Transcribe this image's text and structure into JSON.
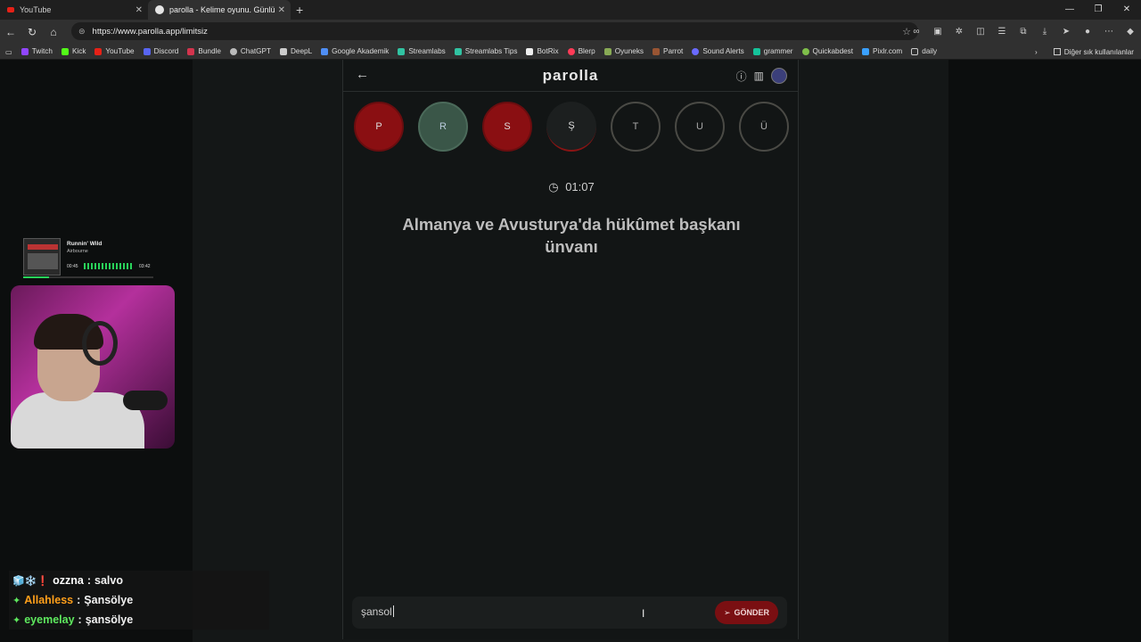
{
  "browser": {
    "tabs": [
      {
        "title": "YouTube",
        "active": false
      },
      {
        "title": "parolla - Kelime oyunu. Günlük ke",
        "active": true
      }
    ],
    "new_tab_label": "+",
    "url": "https://www.parolla.app/limitsiz",
    "bookmarks": [
      "Twitch",
      "Kick",
      "YouTube",
      "Discord",
      "Bundle",
      "ChatGPT",
      "DeepL",
      "Google Akademik",
      "Streamlabs",
      "Streamlabs Tips",
      "BotRix",
      "Blerp",
      "Oyuneks",
      "Parrot",
      "Sound Alerts",
      "grammer",
      "Quickabdest",
      "Pixlr.com",
      "daily"
    ],
    "other_bookmarks": "Diğer sık kullanılanlar"
  },
  "app": {
    "logo": "parolla",
    "letters": [
      {
        "char": "P",
        "state": "wrong"
      },
      {
        "char": "R",
        "state": "correct"
      },
      {
        "char": "S",
        "state": "wrong"
      },
      {
        "char": "Ş",
        "state": "active"
      },
      {
        "char": "T",
        "state": "empty"
      },
      {
        "char": "U",
        "state": "empty"
      },
      {
        "char": "Ü",
        "state": "empty"
      }
    ],
    "timer": "01:07",
    "question": "Almanya ve Avusturya'da hükûmet başkanı ünvanı",
    "answer_value": "şansol",
    "send_label": "GÖNDER"
  },
  "music": {
    "song": "Runnin' Wild",
    "artist": "Airbourne",
    "elapsed": "00:45",
    "total": "03:42",
    "progress": 0.2
  },
  "chat": [
    {
      "user": "ozzna",
      "message": "salvo",
      "user_color": "#ffffff",
      "badge": "🧊❄️❗"
    },
    {
      "user": "Allahless",
      "message": "Şansölye",
      "user_color": "#ff9f1a",
      "badge": "✦"
    },
    {
      "user": "eyemelay",
      "message": "şansölye",
      "user_color": "#5ee85e",
      "badge": "✦"
    }
  ],
  "colors": {
    "wrong": "#8a0f12",
    "correct": "#3a5648",
    "send": "#7a0f12"
  }
}
